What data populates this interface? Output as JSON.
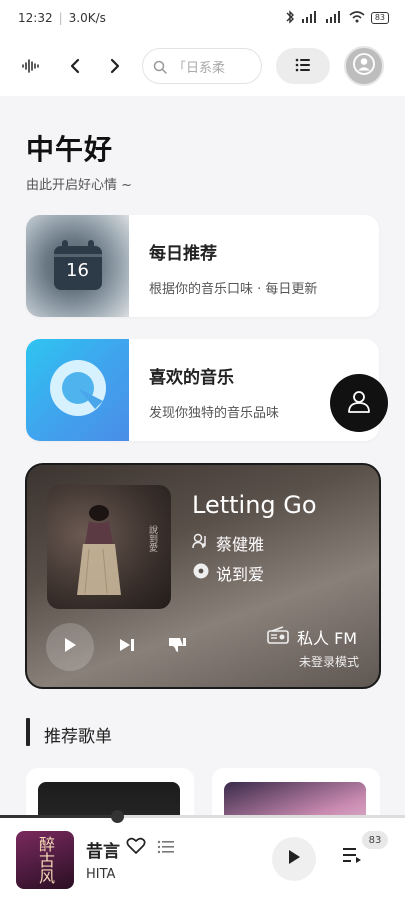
{
  "status": {
    "time": "12:32",
    "speed": "3.0K/s",
    "battery": "83"
  },
  "search": {
    "placeholder": "「日系柔"
  },
  "greeting": {
    "title": "中午好",
    "subtitle": "由此开启好心情 ~"
  },
  "cards": [
    {
      "title": "每日推荐",
      "desc": "根据你的音乐口味 · 每日更新",
      "calendar_day": "16"
    },
    {
      "title": "喜欢的音乐",
      "desc": "发现你独特的音乐品味"
    }
  ],
  "player": {
    "song": "Letting Go",
    "artist": "蔡健雅",
    "album": "说到爱",
    "fm_label": "私人 FM",
    "fm_mode": "未登录模式"
  },
  "section": {
    "title": "推荐歌单"
  },
  "mini_player": {
    "title": "昔言",
    "artist": "HITA",
    "cover_text": "醉古风",
    "queue_count": "83",
    "progress": 0.29
  },
  "icons": {
    "waveform": "waveform-icon",
    "back": "chevron-left-icon",
    "forward": "chevron-right-icon",
    "search": "search-icon",
    "list": "list-icon",
    "avatar": "user-avatar-icon",
    "calendar": "calendar-icon",
    "like": "music-circle-icon",
    "user_float": "user-icon",
    "play": "play-icon",
    "next": "skip-next-icon",
    "dislike": "thumbs-down-icon",
    "radio": "radio-icon",
    "artist": "artist-icon",
    "disc": "disc-icon",
    "heart": "heart-icon",
    "queue": "queue-icon"
  }
}
